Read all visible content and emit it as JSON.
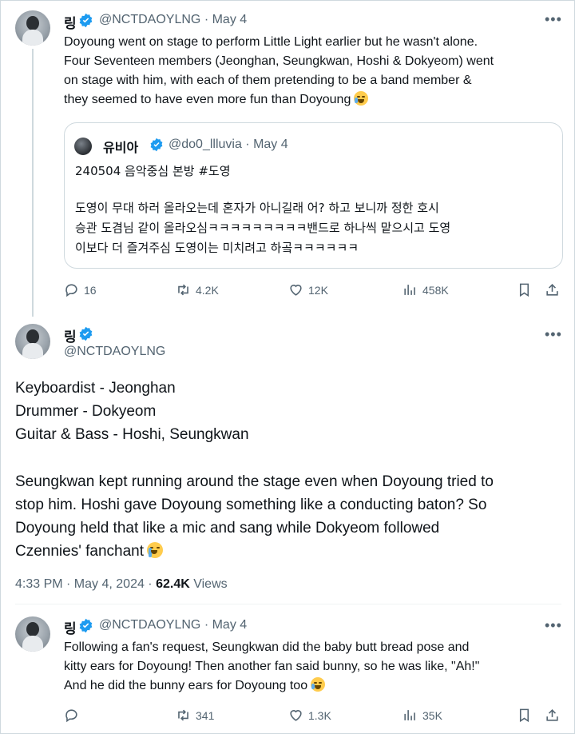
{
  "tweet1": {
    "name": "링",
    "handle_line": "@NCTDAOYLNG · May 4",
    "text_lines": [
      "Doyoung went on stage to perform Little Light earlier but he wasn't alone.",
      "Four Seventeen members (Jeonghan, Seungkwan, Hoshi & Dokyeom) went",
      "on stage with him, with each of them pretending to be a band member &",
      "they seemed to have even more fun than Doyoung"
    ],
    "quote": {
      "name": "유비아",
      "handle_line": "@do0_llluvia · May 4",
      "line1": "240504 음악중심 본방 #도영",
      "body_lines": [
        "도영이 무대 하러 올라오는데 혼자가 아니길래 어? 하고 보니까 정한 호시",
        "승관 도겸님 같이 올라오심ㅋㅋㅋㅋㅋㅋㅋㅋㅋ밴드로 하나씩 맡으시고 도영",
        "이보다 더 즐겨주심 도영이는 미치려고 하곸ㅋㅋㅋㅋㅋㅋ"
      ]
    },
    "replies": "16",
    "reposts": "4.2K",
    "likes": "12K",
    "views": "458K"
  },
  "tweet2": {
    "name": "링",
    "handle": "@NCTDAOYLNG",
    "lines": [
      "Keyboardist - Jeonghan",
      "Drummer - Dokyeom",
      "Guitar & Bass - Hoshi, Seungkwan"
    ],
    "para_lines": [
      "Seungkwan kept running around the stage even when Doyoung tried to",
      "stop him. Hoshi gave Doyoung something like a conducting baton? So",
      "Doyoung held that like a mic and sang while Dokyeom followed",
      "Czennies' fanchant"
    ],
    "time": "4:33 PM · May 4, 2024 · ",
    "views_count": "62.4K",
    "views_label": " Views"
  },
  "tweet3": {
    "name": "링",
    "handle_line": "@NCTDAOYLNG · May 4",
    "text_lines": [
      "Following a fan's request, Seungkwan did the baby butt bread pose and",
      "kitty ears for Doyoung! Then another fan said bunny, so he was like, \"Ah!\"",
      "And he did the bunny ears for Doyoung too"
    ],
    "replies": "",
    "reposts": "341",
    "likes": "1.3K",
    "views": "35K"
  },
  "colors": {
    "verified": "#1d9bf0",
    "secondary": "#536471",
    "border": "#cfd9de"
  },
  "icons": [
    "reply-icon",
    "repost-icon",
    "like-icon",
    "views-icon",
    "bookmark-icon",
    "share-icon",
    "more-icon",
    "verified-icon"
  ]
}
